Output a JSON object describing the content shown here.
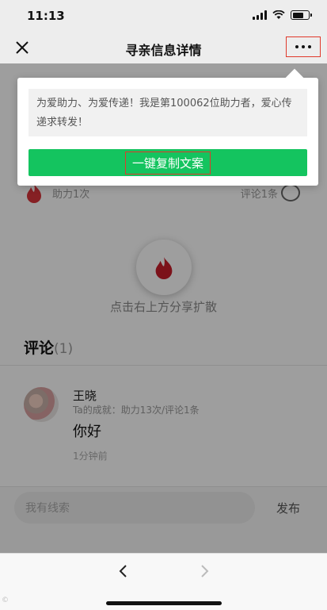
{
  "status_bar": {
    "time": "11:13"
  },
  "nav": {
    "title": "寻亲信息详情",
    "close_icon": "close-icon",
    "more_icon": "more-icon"
  },
  "popup": {
    "message": "为爱助力、为爱传递！我是第100062位助力者，爱心传递求转发！",
    "copy_button_label": "一键复制文案"
  },
  "stats": {
    "help_count": "助力1次",
    "comment_count": "评论1条"
  },
  "share_tip": "点击右上方分享扩散",
  "comments": {
    "title": "评论",
    "count": "(1)",
    "items": [
      {
        "name": "王晓",
        "achievement": "Ta的成就：助力13次/评论1条",
        "text": "你好",
        "time": "1分钟前"
      }
    ]
  },
  "input": {
    "placeholder": "我有线索",
    "publish_label": "发布"
  },
  "watermark": "©"
}
